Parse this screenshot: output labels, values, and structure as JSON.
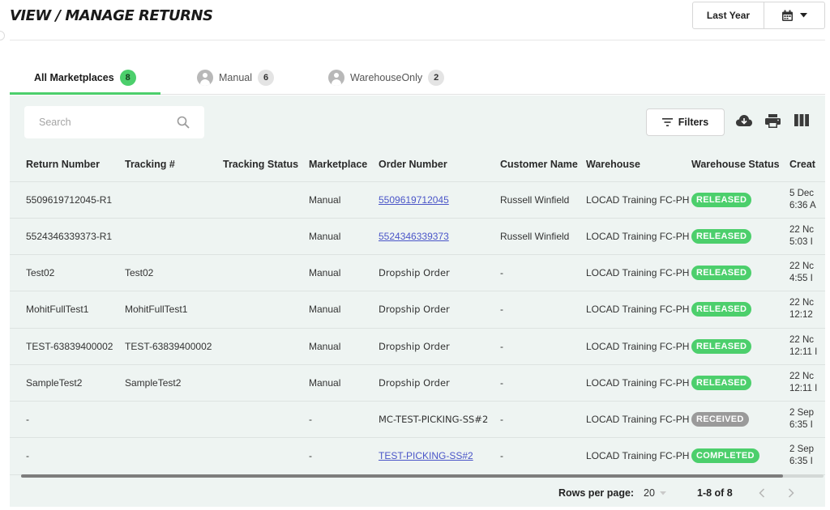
{
  "header": {
    "title": "VIEW / MANAGE RETURNS",
    "date_range": "Last Year",
    "calendar_icon": "calendar-icon",
    "chevron_icon": "caret-down-icon"
  },
  "tabs": [
    {
      "label": "All Marketplaces",
      "count": "8",
      "active": true
    },
    {
      "label": "Manual",
      "count": "6",
      "active": false,
      "icon": "user-avatar-icon"
    },
    {
      "label": "WarehouseOnly",
      "count": "2",
      "active": false,
      "icon": "user-avatar-icon"
    }
  ],
  "toolbar": {
    "search_placeholder": "Search",
    "filters_label": "Filters",
    "icons": [
      "download-cloud-icon",
      "print-icon",
      "columns-icon"
    ]
  },
  "table": {
    "columns": [
      "Return Number",
      "Tracking #",
      "Tracking Status",
      "Marketplace",
      "Order Number",
      "Customer Name",
      "Warehouse",
      "Warehouse Status",
      "Creat"
    ],
    "rows": [
      {
        "return_number": "5509619712045-R1",
        "tracking": "",
        "tracking_status": "",
        "marketplace": "Manual",
        "order_number": "5509619712045",
        "order_is_link": true,
        "customer": "Russell Winfield",
        "warehouse": "LOCAD Training FC-PH",
        "status": "RELEASED",
        "created_1": "5 Dec",
        "created_2": "6:36 A"
      },
      {
        "return_number": "5524346339373-R1",
        "tracking": "",
        "tracking_status": "",
        "marketplace": "Manual",
        "order_number": "5524346339373",
        "order_is_link": true,
        "customer": "Russell Winfield",
        "warehouse": "LOCAD Training FC-PH",
        "status": "RELEASED",
        "created_1": "22 Nc",
        "created_2": "5:03 I"
      },
      {
        "return_number": "Test02",
        "tracking": "Test02",
        "tracking_status": "",
        "marketplace": "Manual",
        "order_number": "Dropship Order",
        "order_is_link": false,
        "customer": "-",
        "warehouse": "LOCAD Training FC-PH",
        "status": "RELEASED",
        "created_1": "22 Nc",
        "created_2": "4:55 I"
      },
      {
        "return_number": "MohitFullTest1",
        "tracking": "MohitFullTest1",
        "tracking_status": "",
        "marketplace": "Manual",
        "order_number": "Dropship Order",
        "order_is_link": false,
        "customer": "-",
        "warehouse": "LOCAD Training FC-PH",
        "status": "RELEASED",
        "created_1": "22 Nc",
        "created_2": "12:12"
      },
      {
        "return_number": "TEST-63839400002",
        "tracking": "TEST-63839400002",
        "tracking_status": "",
        "marketplace": "Manual",
        "order_number": "Dropship Order",
        "order_is_link": false,
        "customer": "-",
        "warehouse": "LOCAD Training FC-PH",
        "status": "RELEASED",
        "created_1": "22 Nc",
        "created_2": "12:11 I"
      },
      {
        "return_number": "SampleTest2",
        "tracking": "SampleTest2",
        "tracking_status": "",
        "marketplace": "Manual",
        "order_number": "Dropship Order",
        "order_is_link": false,
        "customer": "-",
        "warehouse": "LOCAD Training FC-PH",
        "status": "RELEASED",
        "created_1": "22 Nc",
        "created_2": "12:11 I"
      },
      {
        "return_number": "-",
        "tracking": "",
        "tracking_status": "",
        "marketplace": "-",
        "order_number": "MC-TEST-PICKING-SS#2",
        "order_is_link": false,
        "customer": "-",
        "warehouse": "LOCAD Training FC-PH",
        "status": "RECEIVED",
        "created_1": "2 Sep",
        "created_2": "6:35 I"
      },
      {
        "return_number": "-",
        "tracking": "",
        "tracking_status": "",
        "marketplace": "-",
        "order_number": "TEST-PICKING-SS#2",
        "order_is_link": true,
        "customer": "-",
        "warehouse": "LOCAD Training FC-PH",
        "status": "COMPLETED",
        "created_1": "2 Sep",
        "created_2": "6:35 I"
      }
    ]
  },
  "status_colors": {
    "RELEASED": "#4ccf6c",
    "RECEIVED": "#9a9a9a",
    "COMPLETED": "#4ccf6c"
  },
  "pagination": {
    "rows_label": "Rows per page:",
    "rows_value": "20",
    "range": "1-8 of 8",
    "prev_icon": "chevron-left-icon",
    "next_icon": "chevron-right-icon"
  }
}
